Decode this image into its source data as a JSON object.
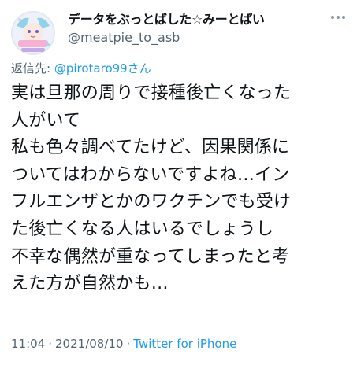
{
  "tweet": {
    "author": {
      "display_name": "データをぶっとばした☆みーとぱい",
      "username": "@meatpie_to_asb",
      "avatar_icon": "anime-avatar-icon"
    },
    "more_icon": "more-horizontal-icon",
    "reply": {
      "prefix": "返信先: ",
      "mention": "@pirotaro99さん"
    },
    "text_lines": [
      "実は旦那の周りで接種後亡くなった",
      "人がいて",
      "私も色々調べてたけど、因果関係に",
      "ついてはわからないですよね…イン",
      "フルエンザとかのワクチンでも受け",
      "た後亡くなる人はいるでしょうし",
      "不幸な偶然が重なってしまったと考",
      "えた方が自然かも…"
    ],
    "timestamp": {
      "time": "11:04",
      "date": "2021/08/10",
      "separator": "·",
      "source": "Twitter for iPhone"
    }
  },
  "colors": {
    "text_primary": "#0f1419",
    "text_secondary": "#536471",
    "link": "#1d9bf0"
  }
}
